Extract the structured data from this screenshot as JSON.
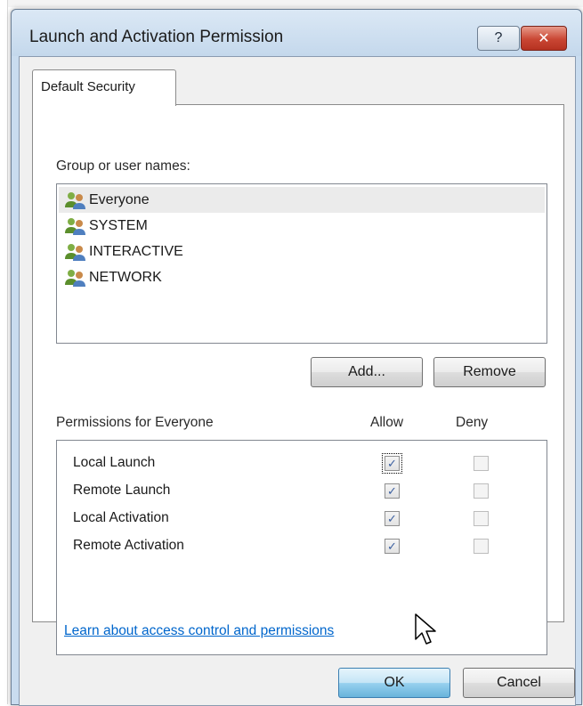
{
  "window": {
    "title": "Launch and Activation Permission",
    "help_label": "?",
    "close_label": "✕"
  },
  "tabs": [
    {
      "label": "Default Security",
      "selected": true
    }
  ],
  "groups": {
    "label": "Group or user names:",
    "items": [
      {
        "name": "Everyone",
        "icon": "user-group-icon",
        "selected": true
      },
      {
        "name": "SYSTEM",
        "icon": "user-group-icon",
        "selected": false
      },
      {
        "name": "INTERACTIVE",
        "icon": "user-group-icon",
        "selected": false
      },
      {
        "name": "NETWORK",
        "icon": "user-group-icon",
        "selected": false
      }
    ],
    "add_label": "Add...",
    "remove_label": "Remove"
  },
  "permissions": {
    "label": "Permissions for Everyone",
    "allow_header": "Allow",
    "deny_header": "Deny",
    "rows": [
      {
        "name": "Local Launch",
        "allow": true,
        "deny": false
      },
      {
        "name": "Remote Launch",
        "allow": true,
        "deny": false
      },
      {
        "name": "Local Activation",
        "allow": true,
        "deny": false
      },
      {
        "name": "Remote Activation",
        "allow": true,
        "deny": false
      }
    ]
  },
  "link": {
    "text": "Learn about access control and permissions"
  },
  "footer": {
    "ok_label": "OK",
    "cancel_label": "Cancel"
  },
  "colors": {
    "accent": "#3c7fb1",
    "link": "#0066cc",
    "close": "#c94633"
  }
}
